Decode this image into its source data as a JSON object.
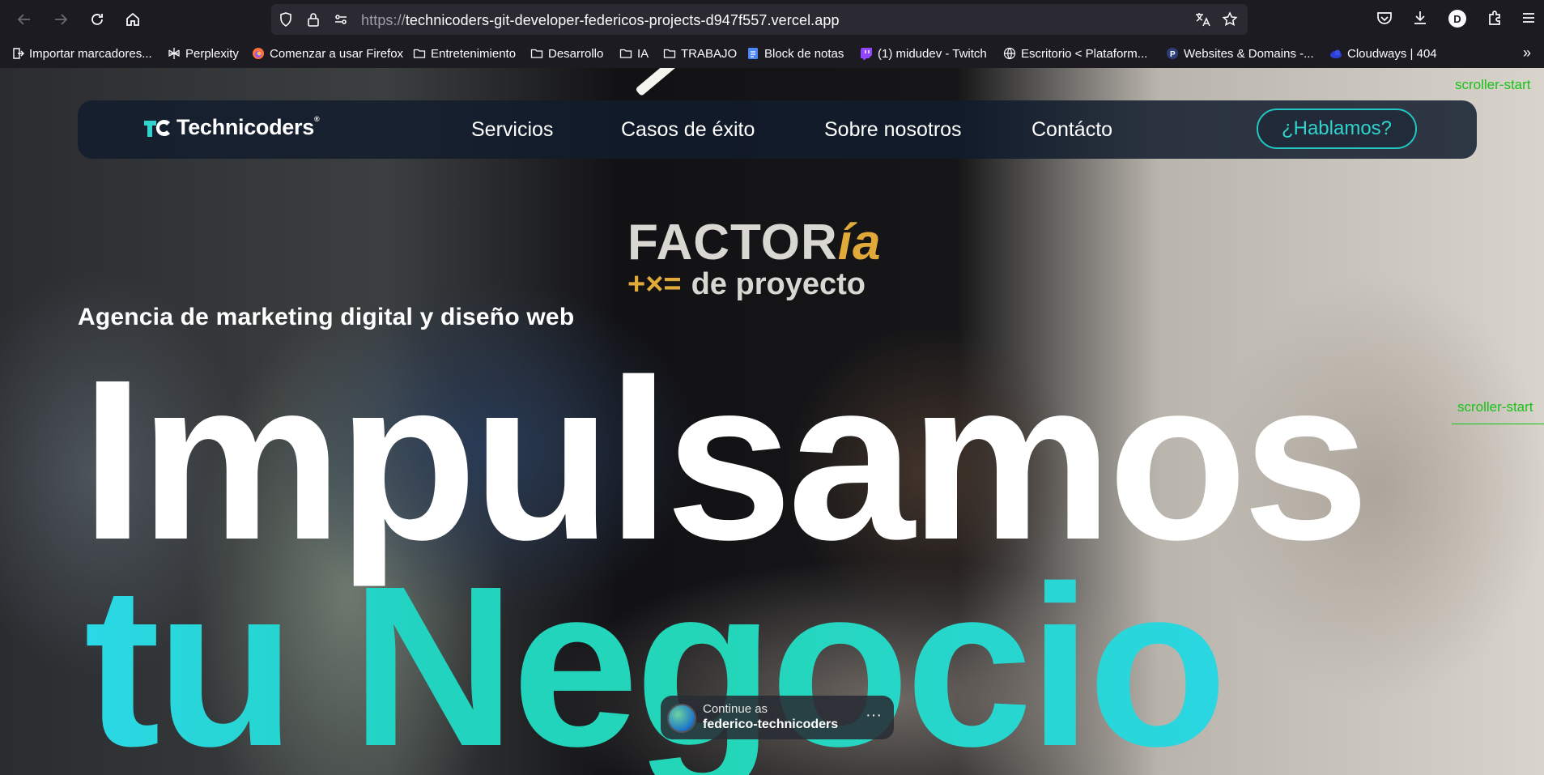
{
  "browser": {
    "url_protocol": "https://",
    "url_host": "technicoders-git-developer-federicos-projects-d947f557.vercel.app",
    "account_initial": "D",
    "bookmarks": [
      {
        "label": "Importar marcadores...",
        "icon": "import-icon"
      },
      {
        "label": "Perplexity",
        "icon": "perplexity-icon"
      },
      {
        "label": "Comenzar a usar Firefox",
        "icon": "firefox-icon"
      },
      {
        "label": "Entretenimiento",
        "icon": "folder-icon"
      },
      {
        "label": "Desarrollo",
        "icon": "folder-icon"
      },
      {
        "label": "IA",
        "icon": "folder-icon"
      },
      {
        "label": "TRABAJO",
        "icon": "folder-icon"
      },
      {
        "label": "Block de notas",
        "icon": "docs-icon"
      },
      {
        "label": "(1) midudev - Twitch",
        "icon": "twitch-icon"
      },
      {
        "label": "Escritorio < Plataform...",
        "icon": "globe-icon"
      },
      {
        "label": "Websites & Domains -...",
        "icon": "plesk-icon"
      },
      {
        "label": "Cloudways | 404",
        "icon": "cloudways-icon"
      }
    ],
    "overflow_label": "»"
  },
  "site": {
    "logo_text": "Technicoders",
    "logo_reg": "®",
    "nav": [
      "Servicios",
      "Casos de éxito",
      "Sobre nosotros",
      "Contácto"
    ],
    "cta": "¿Hablamos?",
    "tagline": "Agencia de marketing digital y diseño web",
    "headline_line1": "Impulsamos",
    "headline_line2": "tu Negocio",
    "background_sign": {
      "word": "FACTOR",
      "accent": "ía",
      "symbols": "+×=",
      "subtitle": "de proyecto"
    },
    "debug_labels": [
      "scroller-start",
      "scroller-start"
    ],
    "accent_color": "#22d3c0"
  },
  "continue_prompt": {
    "label": "Continue as",
    "username": "federico-technicoders",
    "more": "···"
  }
}
